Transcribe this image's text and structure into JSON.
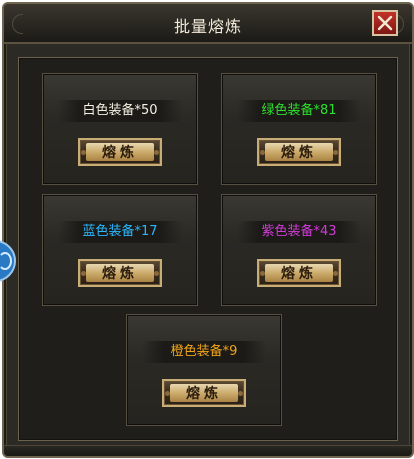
{
  "window": {
    "title": "批量熔炼"
  },
  "colors": {
    "white": "#f4efe2",
    "green": "#2fe02f",
    "blue": "#2ab8ff",
    "purple": "#d23ad8",
    "orange": "#f0a51a"
  },
  "cards": [
    {
      "label": "白色装备*50",
      "color": "#f4efe2",
      "button": "熔炼"
    },
    {
      "label": "绿色装备*81",
      "color": "#2fe02f",
      "button": "熔炼"
    },
    {
      "label": "蓝色装备*17",
      "color": "#2ab8ff",
      "button": "熔炼"
    },
    {
      "label": "紫色装备*43",
      "color": "#d23ad8",
      "button": "熔炼"
    },
    {
      "label": "橙色装备*9",
      "color": "#f0a51a",
      "button": "熔炼"
    }
  ],
  "icons": {
    "close": "close-x-icon",
    "side": "side-tab-icon"
  }
}
